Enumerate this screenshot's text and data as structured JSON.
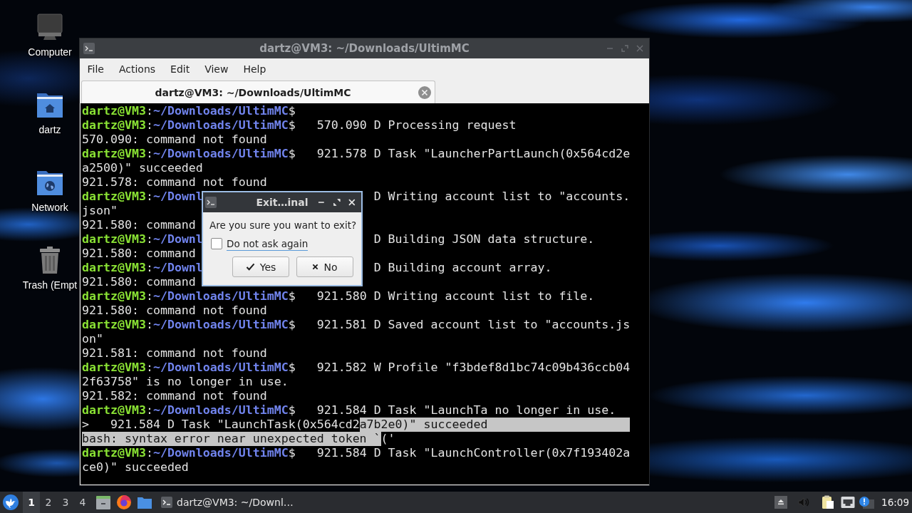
{
  "desktop": {
    "icons": [
      {
        "kind": "computer",
        "label": "Computer"
      },
      {
        "kind": "home",
        "label": "dartz"
      },
      {
        "kind": "network",
        "label": "Network"
      },
      {
        "kind": "trash",
        "label": "Trash (Empt"
      }
    ]
  },
  "window": {
    "title": "dartz@VM3: ~/Downloads/UltimMC",
    "menu": [
      "File",
      "Actions",
      "Edit",
      "View",
      "Help"
    ],
    "tabs": [
      {
        "label": "dartz@VM3: ~/Downloads/UltimMC",
        "selected": true
      }
    ],
    "terminal": {
      "rows": [
        {
          "segments": [
            {
              "kind": "user",
              "text": "dartz@VM3"
            },
            {
              "kind": "text",
              "text": ":"
            },
            {
              "kind": "path",
              "text": "~/Downloads/UltimMC"
            },
            {
              "kind": "text",
              "text": "$"
            }
          ]
        },
        {
          "segments": [
            {
              "kind": "user",
              "text": "dartz@VM3"
            },
            {
              "kind": "text",
              "text": ":"
            },
            {
              "kind": "path",
              "text": "~/Downloads/UltimMC"
            },
            {
              "kind": "text",
              "text": "$   570.090 D Processing request"
            }
          ]
        },
        {
          "segments": [
            {
              "kind": "text",
              "text": "570.090: command not found"
            }
          ]
        },
        {
          "segments": [
            {
              "kind": "user",
              "text": "dartz@VM3"
            },
            {
              "kind": "text",
              "text": ":"
            },
            {
              "kind": "path",
              "text": "~/Downloads/UltimMC"
            },
            {
              "kind": "text",
              "text": "$   921.578 D Task \"LauncherPartLaunch(0x564cd2e"
            }
          ]
        },
        {
          "segments": [
            {
              "kind": "text",
              "text": "a2500)\" succeeded"
            }
          ]
        },
        {
          "segments": [
            {
              "kind": "text",
              "text": "921.578: command not found"
            }
          ]
        },
        {
          "segments": [
            {
              "kind": "user",
              "text": "dartz@VM3"
            },
            {
              "kind": "text",
              "text": ":"
            },
            {
              "kind": "path",
              "text": "~/Downl"
            }
          ],
          "after_dialog": [
            {
              "kind": "text",
              "text": "D Writing account list to \"accounts."
            }
          ]
        },
        {
          "segments": [
            {
              "kind": "text",
              "text": "json\""
            }
          ]
        },
        {
          "segments": [
            {
              "kind": "text",
              "text": "921.580: command"
            }
          ]
        },
        {
          "segments": [
            {
              "kind": "user",
              "text": "dartz@VM3"
            },
            {
              "kind": "text",
              "text": ":"
            },
            {
              "kind": "path",
              "text": "~/Downl"
            }
          ],
          "after_dialog": [
            {
              "kind": "text",
              "text": "D Building JSON data structure."
            }
          ]
        },
        {
          "segments": [
            {
              "kind": "text",
              "text": "921.580: command"
            }
          ]
        },
        {
          "segments": [
            {
              "kind": "user",
              "text": "dartz@VM3"
            },
            {
              "kind": "text",
              "text": ":"
            },
            {
              "kind": "path",
              "text": "~/Downl"
            }
          ],
          "after_dialog": [
            {
              "kind": "text",
              "text": "D Building account array."
            }
          ]
        },
        {
          "segments": [
            {
              "kind": "text",
              "text": "921.580: command"
            }
          ]
        },
        {
          "segments": [
            {
              "kind": "user",
              "text": "dartz@VM3"
            },
            {
              "kind": "text",
              "text": ":"
            },
            {
              "kind": "path",
              "text": "~/Downloads/UltimMC"
            },
            {
              "kind": "text",
              "text": "$   921.580 D Writing account list to file."
            }
          ]
        },
        {
          "segments": [
            {
              "kind": "text",
              "text": "921.580: command not found"
            }
          ]
        },
        {
          "segments": [
            {
              "kind": "user",
              "text": "dartz@VM3"
            },
            {
              "kind": "text",
              "text": ":"
            },
            {
              "kind": "path",
              "text": "~/Downloads/UltimMC"
            },
            {
              "kind": "text",
              "text": "$   921.581 D Saved account list to \"accounts.js"
            }
          ]
        },
        {
          "segments": [
            {
              "kind": "text",
              "text": "on\""
            }
          ]
        },
        {
          "segments": [
            {
              "kind": "text",
              "text": "921.581: command not found"
            }
          ]
        },
        {
          "segments": [
            {
              "kind": "user",
              "text": "dartz@VM3"
            },
            {
              "kind": "text",
              "text": ":"
            },
            {
              "kind": "path",
              "text": "~/Downloads/UltimMC"
            },
            {
              "kind": "text",
              "text": "$   921.582 W Profile \"f3bdef8d1bc74c09b436ccb04"
            }
          ]
        },
        {
          "segments": [
            {
              "kind": "text",
              "text": "2f63758\" is no longer in use."
            }
          ]
        },
        {
          "segments": [
            {
              "kind": "text",
              "text": "921.582: command not found"
            }
          ]
        },
        {
          "segments": [
            {
              "kind": "user",
              "text": "dartz@VM3"
            },
            {
              "kind": "text",
              "text": ":"
            },
            {
              "kind": "path",
              "text": "~/Downloads/UltimMC"
            },
            {
              "kind": "text",
              "text": "$   921.584 D Task \"LaunchTa no longer in use."
            }
          ]
        },
        {
          "segments": [
            {
              "kind": "text",
              "text": ">   921.584 D Task \"LaunchTask(0x564cd2"
            },
            {
              "kind": "selection",
              "text": "a7b2e0)\" succeeded"
            }
          ]
        },
        {
          "segments": [
            {
              "kind": "selection",
              "text": "bash: syntax error near unexpected token `"
            },
            {
              "kind": "text",
              "text": "('"
            }
          ]
        },
        {
          "segments": [
            {
              "kind": "user",
              "text": "dartz@VM3"
            },
            {
              "kind": "text",
              "text": ":"
            },
            {
              "kind": "path",
              "text": "~/Downloads/UltimMC"
            },
            {
              "kind": "text",
              "text": "$   921.584 D Task \"LaunchController(0x7f193402a"
            }
          ]
        },
        {
          "segments": [
            {
              "kind": "text",
              "text": "ce0)\" succeeded"
            }
          ]
        }
      ]
    }
  },
  "dialog": {
    "title": "Exit…inal",
    "message": "Are you sure you want to exit?",
    "checkbox": {
      "label": "Do not ask again",
      "checked": false,
      "focused": true
    },
    "buttons": [
      {
        "kind": "yes",
        "label": "Yes"
      },
      {
        "kind": "no",
        "label": "No"
      }
    ]
  },
  "taskbar": {
    "workspaces": [
      {
        "label": "1",
        "selected": true
      },
      {
        "label": "2",
        "selected": false
      },
      {
        "label": "3",
        "selected": false
      },
      {
        "label": "4",
        "selected": false
      }
    ],
    "tasks": [
      {
        "label": "dartz@VM3: ~/Downl…"
      }
    ],
    "clock": "16:09"
  }
}
